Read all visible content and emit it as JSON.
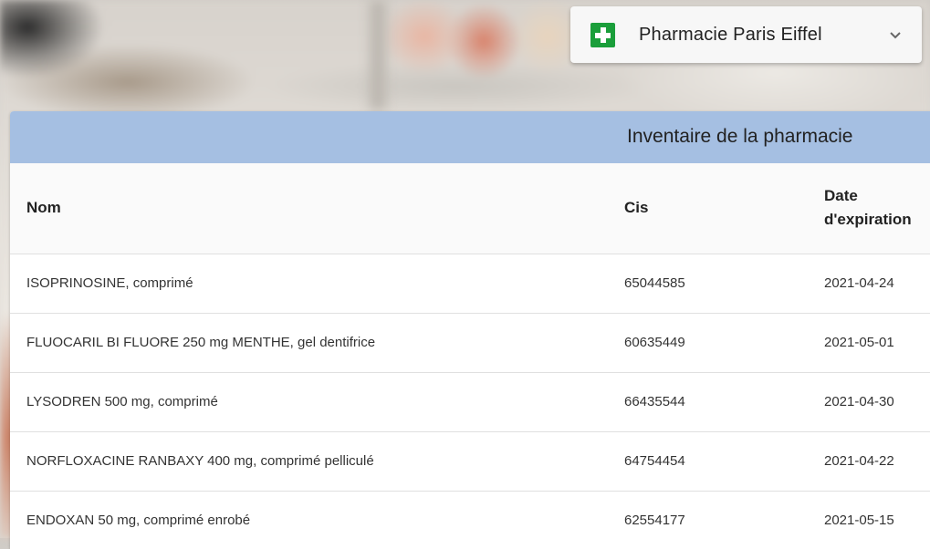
{
  "store": {
    "name": "Pharmacie Paris Eiffel",
    "icon": "green-cross-icon",
    "dropdown_icon": "chevron-down-icon"
  },
  "inventory": {
    "title": "Inventaire de la pharmacie",
    "columns": {
      "nom": "Nom",
      "cis": "Cis",
      "date": "Date d'expiration"
    },
    "rows": [
      {
        "nom": "ISOPRINOSINE, comprimé",
        "cis": "65044585",
        "date": "2021-04-24"
      },
      {
        "nom": "FLUOCARIL BI FLUORE 250 mg MENTHE, gel dentifrice",
        "cis": "60635449",
        "date": "2021-05-01"
      },
      {
        "nom": "LYSODREN 500 mg, comprimé",
        "cis": "66435544",
        "date": "2021-04-30"
      },
      {
        "nom": "NORFLOXACINE RANBAXY 400 mg, comprimé pelliculé",
        "cis": "64754454",
        "date": "2021-04-22"
      },
      {
        "nom": "ENDOXAN 50 mg, comprimé enrobé",
        "cis": "62554177",
        "date": "2021-05-15"
      }
    ]
  },
  "colors": {
    "header_bg": "#a5bfe2",
    "cross": "#1a9e3a"
  }
}
